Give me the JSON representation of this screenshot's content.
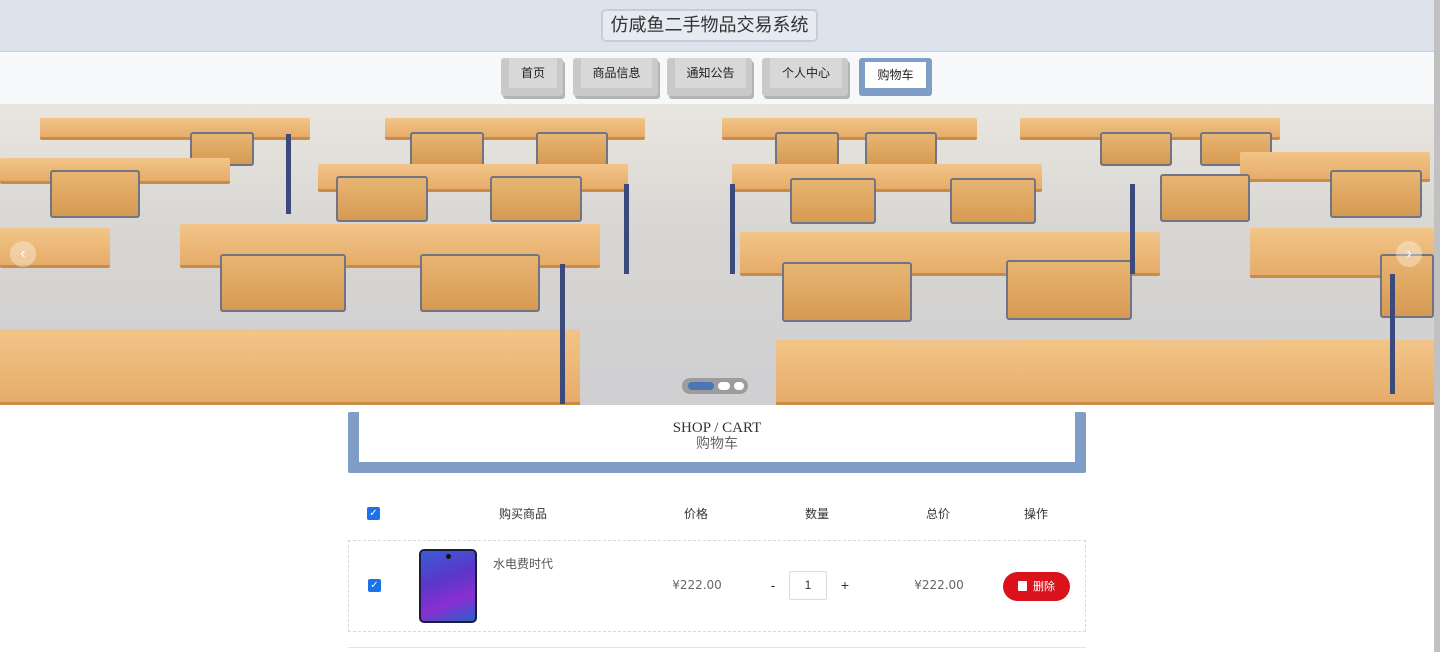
{
  "header": {
    "title": "仿咸鱼二手物品交易系统"
  },
  "nav": {
    "items": [
      {
        "label": "首页",
        "active": false
      },
      {
        "label": "商品信息",
        "active": false
      },
      {
        "label": "通知公告",
        "active": false
      },
      {
        "label": "个人中心",
        "active": false
      },
      {
        "label": "购物车",
        "active": true
      }
    ]
  },
  "banner": {
    "slide_count": 3,
    "active_slide": 1,
    "prev_icon": "chevron-left-icon",
    "next_icon": "chevron-right-icon",
    "prev_glyph": "‹",
    "next_glyph": "›"
  },
  "section": {
    "title_en": "SHOP / CART",
    "title_cn": "购物车"
  },
  "cart": {
    "columns": {
      "product": "购买商品",
      "price": "价格",
      "quantity": "数量",
      "total": "总价",
      "action": "操作"
    },
    "select_all_checked": true,
    "items": [
      {
        "checked": true,
        "name": "水电费时代",
        "price": "¥222.00",
        "quantity": "1",
        "total": "¥222.00",
        "delete_label": "删除"
      }
    ],
    "minus": "-",
    "plus": "+",
    "check_glyph": "✓"
  },
  "colors": {
    "accent": "#7f9dc6",
    "delete": "#d9121b",
    "checkbox": "#1a73e8"
  }
}
